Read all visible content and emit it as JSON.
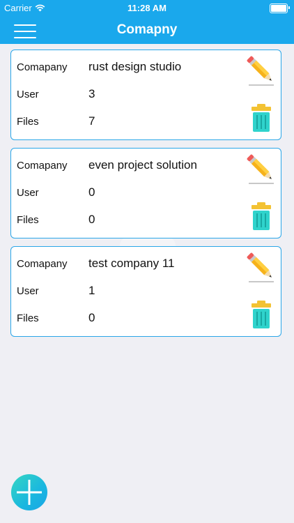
{
  "status_bar": {
    "carrier": "Carrier",
    "time": "11:28 AM"
  },
  "header": {
    "title": "Comapny",
    "color": "#1aa8ec"
  },
  "labels": {
    "company": "Comapany",
    "user": "User",
    "files": "Files"
  },
  "companies": [
    {
      "name": "rust design studio",
      "user": "3",
      "files": "7"
    },
    {
      "name": "even project solution",
      "user": "0",
      "files": "0"
    },
    {
      "name": "test company 11",
      "user": "1",
      "files": "0"
    }
  ],
  "icons": {
    "menu": "hamburger-icon",
    "edit": "pencil-icon",
    "delete": "trash-icon",
    "add": "plus-icon",
    "wifi": "wifi-icon",
    "battery": "battery-icon"
  }
}
